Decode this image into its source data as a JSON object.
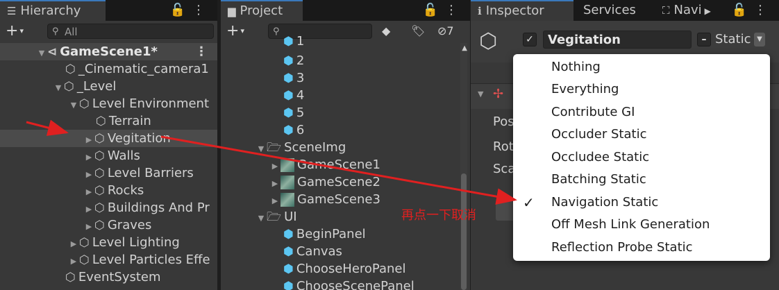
{
  "hierarchy": {
    "tab_label": "Hierarchy",
    "search_placeholder": "All",
    "scene_name": "GameScene1*",
    "rows": [
      {
        "label": "_Cinematic_camera1"
      },
      {
        "label": "_Level"
      },
      {
        "label": "Level Environment"
      },
      {
        "label": "Terrain"
      },
      {
        "label": "Vegitation"
      },
      {
        "label": "Walls"
      },
      {
        "label": "Level Barriers"
      },
      {
        "label": "Rocks"
      },
      {
        "label": "Buildings And Pr"
      },
      {
        "label": "Graves"
      },
      {
        "label": "Level Lighting"
      },
      {
        "label": "Level Particles Effe"
      },
      {
        "label": "EventSystem"
      }
    ]
  },
  "project": {
    "tab_label": "Project",
    "hidden_count": "7",
    "rows": [
      {
        "label": "1"
      },
      {
        "label": "2"
      },
      {
        "label": "3"
      },
      {
        "label": "4"
      },
      {
        "label": "5"
      },
      {
        "label": "6"
      },
      {
        "label": "SceneImg"
      },
      {
        "label": "GameScene1"
      },
      {
        "label": "GameScene2"
      },
      {
        "label": "GameScene3"
      },
      {
        "label": "UI"
      },
      {
        "label": "BeginPanel"
      },
      {
        "label": "Canvas"
      },
      {
        "label": "ChooseHeroPanel"
      },
      {
        "label": "ChooseScenePanel"
      }
    ]
  },
  "inspector": {
    "tabs": [
      "Inspector",
      "Services",
      "Navi"
    ],
    "object_name": "Vegitation",
    "static_label": "Static",
    "field_labels": [
      "Pos",
      "Rot",
      "Sca"
    ]
  },
  "static_menu": {
    "items": [
      {
        "label": "Nothing",
        "checked": false
      },
      {
        "label": "Everything",
        "checked": false
      },
      {
        "label": "Contribute GI",
        "checked": false
      },
      {
        "label": "Occluder Static",
        "checked": false
      },
      {
        "label": "Occludee Static",
        "checked": false
      },
      {
        "label": "Batching Static",
        "checked": false
      },
      {
        "label": "Navigation Static",
        "checked": true
      },
      {
        "label": "Off Mesh Link Generation",
        "checked": false
      },
      {
        "label": "Reflection Probe Static",
        "checked": false
      }
    ],
    "check_glyph": "✓"
  },
  "annotation": {
    "text": "再点一下取消",
    "color": "#e02020"
  },
  "colors": {
    "accent": "#3a79bb",
    "prefab_blue": "#5cc6f2"
  }
}
